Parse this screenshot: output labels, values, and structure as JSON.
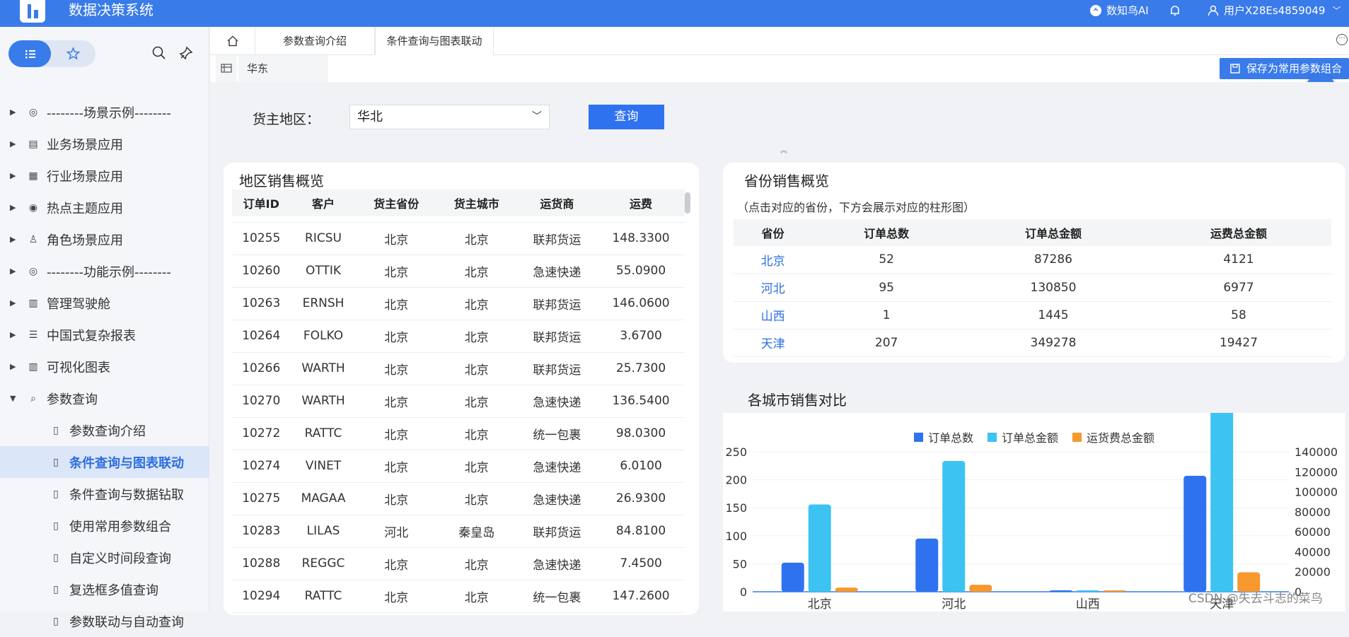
{
  "app": {
    "title": "数据决策系统",
    "ai_label": "数知鸟AI",
    "user": "用户X28Es4859049"
  },
  "sidebar": {
    "items": [
      {
        "label": "--------场景示例--------",
        "icon": "scene-icon"
      },
      {
        "label": "业务场景应用",
        "icon": "clipboard-icon"
      },
      {
        "label": "行业场景应用",
        "icon": "grid-icon"
      },
      {
        "label": "热点主题应用",
        "icon": "target-icon"
      },
      {
        "label": "角色场景应用",
        "icon": "user-list-icon"
      },
      {
        "label": "--------功能示例--------",
        "icon": "scene-icon"
      },
      {
        "label": "管理驾驶舱",
        "icon": "dashboard-icon"
      },
      {
        "label": "中国式复杂报表",
        "icon": "sliders-icon"
      },
      {
        "label": "可视化图表",
        "icon": "chart-icon"
      },
      {
        "label": "参数查询",
        "icon": "search-doc-icon"
      }
    ],
    "sub_items": [
      {
        "label": "参数查询介绍",
        "active": false
      },
      {
        "label": "条件查询与图表联动",
        "active": true
      },
      {
        "label": "条件查询与数据钻取",
        "active": false
      },
      {
        "label": "使用常用参数组合",
        "active": false
      },
      {
        "label": "自定义时间段查询",
        "active": false
      },
      {
        "label": "复选框多值查询",
        "active": false
      },
      {
        "label": "参数联动与自动查询",
        "active": false
      }
    ]
  },
  "tabs": [
    {
      "label": "参数查询介绍"
    },
    {
      "label": "条件查询与图表联动"
    }
  ],
  "crumb": {
    "label": "华东"
  },
  "toolbar": {
    "save_label": "保存为常用参数组合"
  },
  "query": {
    "label": "货主地区：",
    "value": "华北",
    "button": "查询"
  },
  "region_table": {
    "title": "地区销售概览",
    "headers": [
      "订单ID",
      "客户",
      "货主省份",
      "货主城市",
      "运货商",
      "运费"
    ],
    "rows": [
      [
        "10255",
        "RICSU",
        "北京",
        "北京",
        "联邦货运",
        "148.3300"
      ],
      [
        "10260",
        "OTTIK",
        "北京",
        "北京",
        "急速快递",
        "55.0900"
      ],
      [
        "10263",
        "ERNSH",
        "北京",
        "北京",
        "联邦货运",
        "146.0600"
      ],
      [
        "10264",
        "FOLKO",
        "北京",
        "北京",
        "联邦货运",
        "3.6700"
      ],
      [
        "10266",
        "WARTH",
        "北京",
        "北京",
        "联邦货运",
        "25.7300"
      ],
      [
        "10270",
        "WARTH",
        "北京",
        "北京",
        "急速快递",
        "136.5400"
      ],
      [
        "10272",
        "RATTC",
        "北京",
        "北京",
        "统一包裹",
        "98.0300"
      ],
      [
        "10274",
        "VINET",
        "北京",
        "北京",
        "急速快递",
        "6.0100"
      ],
      [
        "10275",
        "MAGAA",
        "北京",
        "北京",
        "急速快递",
        "26.9300"
      ],
      [
        "10283",
        "LILAS",
        "河北",
        "秦皇岛",
        "联邦货运",
        "84.8100"
      ],
      [
        "10288",
        "REGGC",
        "北京",
        "北京",
        "急速快递",
        "7.4500"
      ],
      [
        "10294",
        "RATTC",
        "北京",
        "北京",
        "统一包裹",
        "147.2600"
      ]
    ]
  },
  "province_table": {
    "title": "省份销售概览",
    "hint": "（点击对应的省份，下方会展示对应的柱形图）",
    "headers": [
      "省份",
      "订单总数",
      "订单总金额",
      "运费总金额"
    ],
    "rows": [
      [
        "北京",
        "52",
        "87286",
        "4121"
      ],
      [
        "河北",
        "95",
        "130850",
        "6977"
      ],
      [
        "山西",
        "1",
        "1445",
        "58"
      ],
      [
        "天津",
        "207",
        "349278",
        "19427"
      ]
    ]
  },
  "chart_title": "各城市销售对比",
  "chart_data": {
    "type": "bar",
    "categories": [
      "北京",
      "河北",
      "山西",
      "天津"
    ],
    "series": [
      {
        "name": "订单总数",
        "values": [
          52,
          95,
          1,
          207
        ],
        "axis": "left",
        "color": "#2f72f0"
      },
      {
        "name": "订单总金额",
        "values": [
          87286,
          130850,
          1445,
          349278
        ],
        "axis": "right",
        "color": "#3cc3f2"
      },
      {
        "name": "运货费总金额",
        "values": [
          4121,
          6977,
          58,
          19427
        ],
        "axis": "right",
        "color": "#f7992c"
      }
    ],
    "y_left": {
      "ticks": [
        "0",
        "50",
        "100",
        "150",
        "200",
        "250"
      ],
      "range": [
        0,
        250
      ]
    },
    "y_right": {
      "ticks": [
        "0",
        "20000",
        "40000",
        "60000",
        "80000",
        "100000",
        "120000",
        "140000"
      ],
      "range": [
        0,
        140000
      ]
    },
    "legend_position": "top"
  },
  "watermark": "CSDN @失去斗志的菜鸟"
}
